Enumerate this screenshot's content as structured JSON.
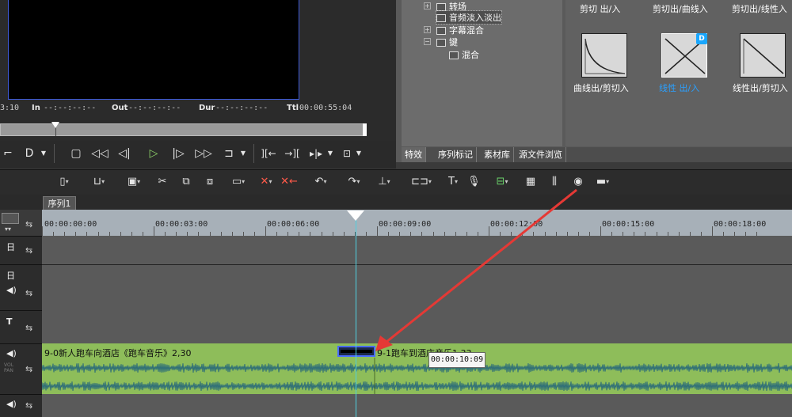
{
  "preview": {
    "timecode_left": "3:10",
    "in_label": "In",
    "in_value": "--:--:--:--",
    "out_label": "Out",
    "out_value": "--:--:--:--",
    "dur_label": "Dur",
    "dur_value": "--:--:--:--",
    "ttl_label": "Ttl",
    "ttl_value": "00:00:55:04"
  },
  "effects_tree": {
    "items": [
      {
        "label": "转场"
      },
      {
        "label": "音频淡入淡出"
      },
      {
        "label": "字幕混合"
      },
      {
        "label": "键"
      },
      {
        "label": "混合"
      }
    ]
  },
  "effects_gallery": {
    "top_labels": [
      "剪切 出/入",
      "剪切出/曲线入",
      "剪切出/线性入"
    ],
    "items": [
      {
        "label": "曲线出/剪切入"
      },
      {
        "label": "线性 出/入",
        "badge": "D"
      },
      {
        "label": "线性出/剪切入"
      }
    ]
  },
  "effects_tabs": [
    "特效",
    "序列标记",
    "素材库",
    "源文件浏览"
  ],
  "sequence": {
    "tab_label": "序列1"
  },
  "ruler": {
    "labels": [
      "00:00:00:00",
      "00:00:03:00",
      "00:00:06:00",
      "00:00:09:00",
      "00:00:12:00",
      "00:00:15:00",
      "00:00:18:00"
    ]
  },
  "track_heads": {
    "vol_label": "VOL\nPAN"
  },
  "audio_track": {
    "clip1_title": "9-0新人跑车向酒店《跑车音乐》2,30",
    "clip2_title": "9-1跑车到酒店音乐1,33"
  },
  "tooltip": {
    "text": "00:00:10:09"
  },
  "colors": {
    "accent": "#3f5bd8",
    "audio_clip": "#8ebd5a",
    "playhead": "#4fd0e0",
    "arrow": "#e53935",
    "badge": "#19a7ff"
  }
}
